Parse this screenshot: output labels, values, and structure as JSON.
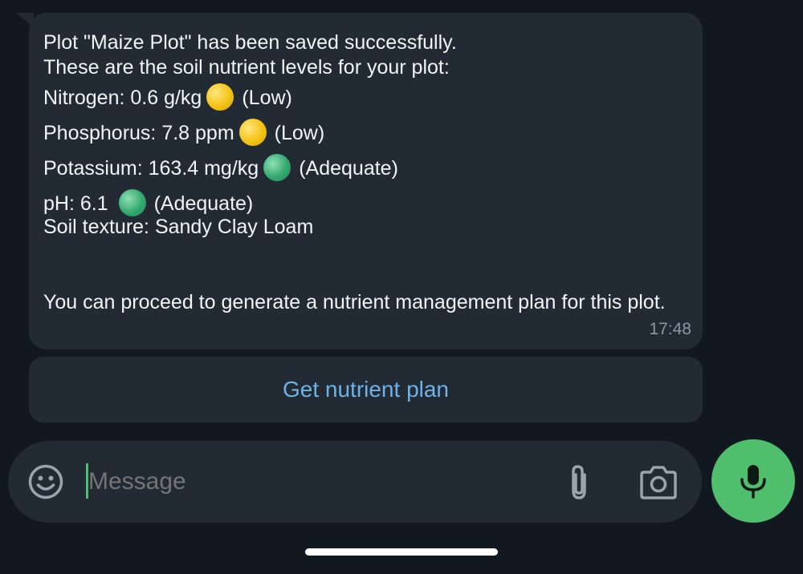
{
  "message": {
    "line1": "Plot \"Maize Plot\" has been saved successfully.",
    "line2": "These are the soil nutrient levels for your plot:",
    "nutrients": [
      {
        "label": "Nitrogen: 0.6 g/kg",
        "status": "(Low)",
        "indicator": "yellow-circle-icon",
        "color": "#f3c316"
      },
      {
        "label": "Phosphorus: 7.8 ppm",
        "status": "(Low)",
        "indicator": "yellow-circle-icon",
        "color": "#f3c316"
      },
      {
        "label": "Potassium: 163.4 mg/kg",
        "status": "(Adequate)",
        "indicator": "green-circle-icon",
        "color": "#35a870"
      },
      {
        "label": "pH: 6.1 ",
        "status": "(Adequate)",
        "indicator": "green-circle-icon",
        "color": "#35a870"
      }
    ],
    "texture": "Soil texture: Sandy Clay Loam",
    "footer": "You can proceed to generate a nutrient management plan for this plot.",
    "time": "17:48"
  },
  "inline_button": {
    "label": "Get nutrient plan"
  },
  "composer": {
    "placeholder": "Message",
    "emoji_icon": "smiley-icon",
    "attach_icon": "paperclip-icon",
    "camera_icon": "camera-icon",
    "mic_icon": "microphone-icon"
  },
  "colors": {
    "background": "#111820",
    "bubble": "#222a33",
    "accent_green": "#4fbf6e",
    "link_blue": "#6db3e8"
  }
}
